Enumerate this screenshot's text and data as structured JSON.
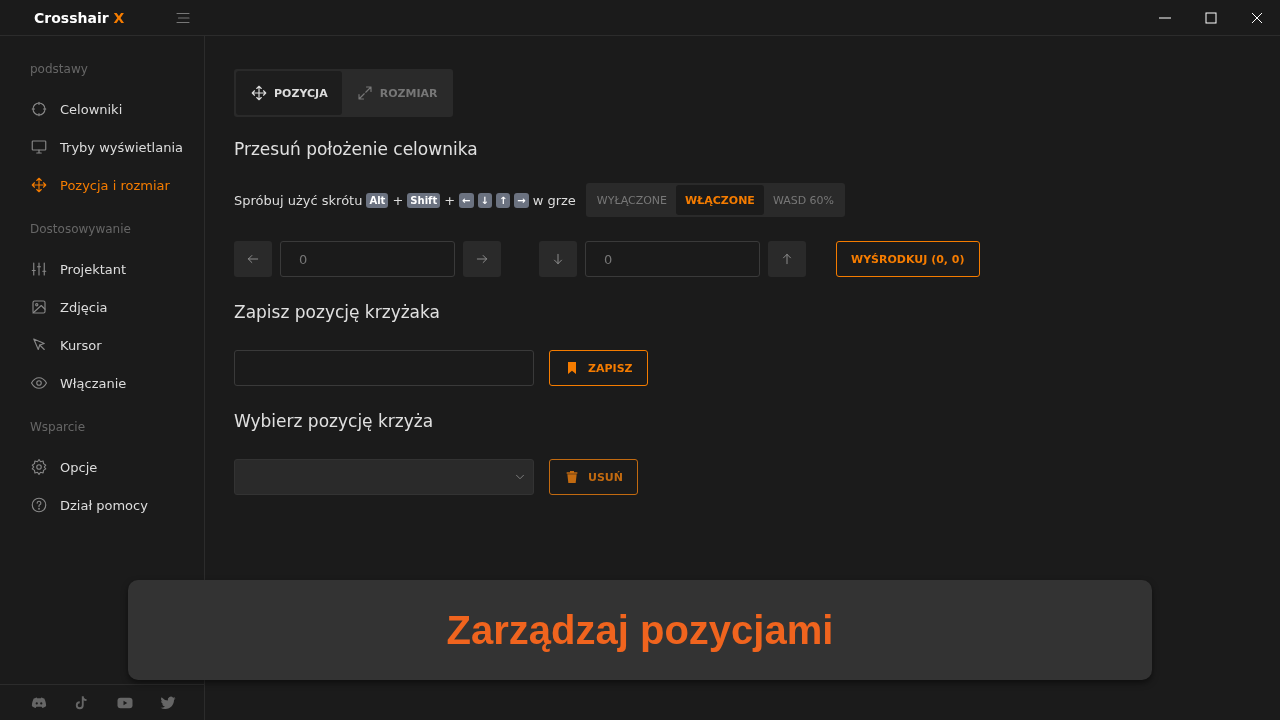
{
  "window": {
    "title": "Crosshair",
    "title_accent": "X"
  },
  "sidebar": {
    "sections": [
      {
        "heading": "podstawy",
        "items": [
          {
            "label": "Celowniki",
            "selected": false
          },
          {
            "label": "Tryby wyświetlania",
            "selected": false
          },
          {
            "label": "Pozycja i rozmiar",
            "selected": true
          }
        ]
      },
      {
        "heading": "Dostosowywanie",
        "items": [
          {
            "label": "Projektant",
            "selected": false
          },
          {
            "label": "Zdjęcia",
            "selected": false
          },
          {
            "label": "Kursor",
            "selected": false
          },
          {
            "label": "Włączanie",
            "selected": false
          }
        ]
      },
      {
        "heading": "Wsparcie",
        "items": [
          {
            "label": "Opcje",
            "selected": false
          },
          {
            "label": "Dział pomocy",
            "selected": false
          }
        ]
      }
    ]
  },
  "tabs": [
    {
      "label": "POZYCJA",
      "selected": true
    },
    {
      "label": "ROZMIAR",
      "selected": false
    }
  ],
  "move_section": {
    "title": "Przesuń położenie celownika",
    "hint": [
      {
        "kind": "text",
        "text": "Spróbuj użyć skrótu"
      },
      {
        "kind": "key",
        "text": "Alt"
      },
      {
        "kind": "text",
        "text": "+"
      },
      {
        "kind": "key",
        "text": "Shift"
      },
      {
        "kind": "text",
        "text": "+"
      },
      {
        "kind": "key",
        "text": "←"
      },
      {
        "kind": "key",
        "text": "↓"
      },
      {
        "kind": "key",
        "text": "↑"
      },
      {
        "kind": "key",
        "text": "→"
      },
      {
        "kind": "text",
        "text": "w grze"
      }
    ],
    "modes": [
      {
        "label": "WYŁĄCZONE",
        "selected": false
      },
      {
        "label": "WŁĄCZONE",
        "selected": true
      },
      {
        "label": "WASD 60%",
        "selected": false
      }
    ],
    "x_value": "0",
    "y_value": "0",
    "center_button": "WYŚRODKUJ (0, 0)"
  },
  "save_section": {
    "title": "Zapisz pozycję krzyżaka",
    "button": "ZAPISZ"
  },
  "select_section": {
    "title": "Wybierz pozycję krzyża",
    "button": "USUŃ"
  },
  "caption": "Zarządzaj pozycjami"
}
